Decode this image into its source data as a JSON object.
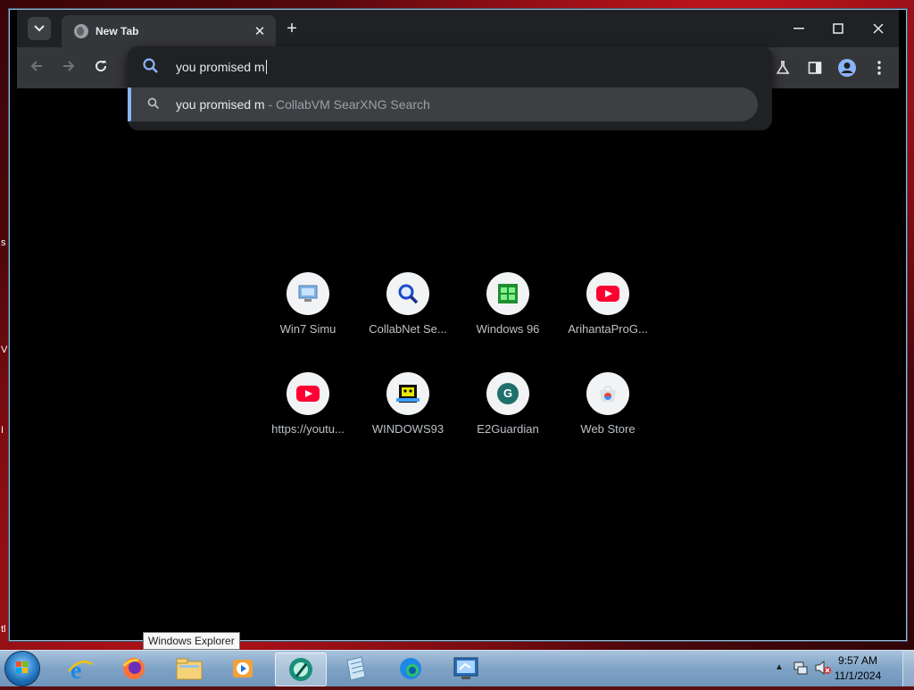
{
  "browser": {
    "tab_title": "New Tab",
    "omnibox_text": "you promised m",
    "suggestion": {
      "query": "you promised m",
      "provider": " - CollabVM SearXNG Search"
    }
  },
  "shortcuts": [
    {
      "label": "Win7 Simu",
      "icon": "win7-icon"
    },
    {
      "label": "CollabNet Se...",
      "icon": "magnifier-icon"
    },
    {
      "label": "Windows 96",
      "icon": "windows96-icon"
    },
    {
      "label": "ArihantaProG...",
      "icon": "youtube-icon"
    },
    {
      "label": "https://youtu...",
      "icon": "youtube-icon"
    },
    {
      "label": "WINDOWS93",
      "icon": "windows93-icon"
    },
    {
      "label": "E2Guardian",
      "icon": "letter-g-icon",
      "letter": "G"
    },
    {
      "label": "Web Store",
      "icon": "web-store-icon"
    }
  ],
  "taskbar": {
    "tooltip": "Windows Explorer",
    "time": "9:57 AM",
    "date": "11/1/2024",
    "apps": [
      "internet-explorer-icon",
      "firefox-icon",
      "windows-explorer-icon",
      "media-player-icon",
      "active-app-icon",
      "notepad-icon",
      "edge-icon",
      "remote-desktop-icon"
    ]
  },
  "colors": {
    "accent": "#8ab4f8",
    "youtube_red": "#ff0033",
    "e2guardian_teal": "#1f6f6a"
  }
}
